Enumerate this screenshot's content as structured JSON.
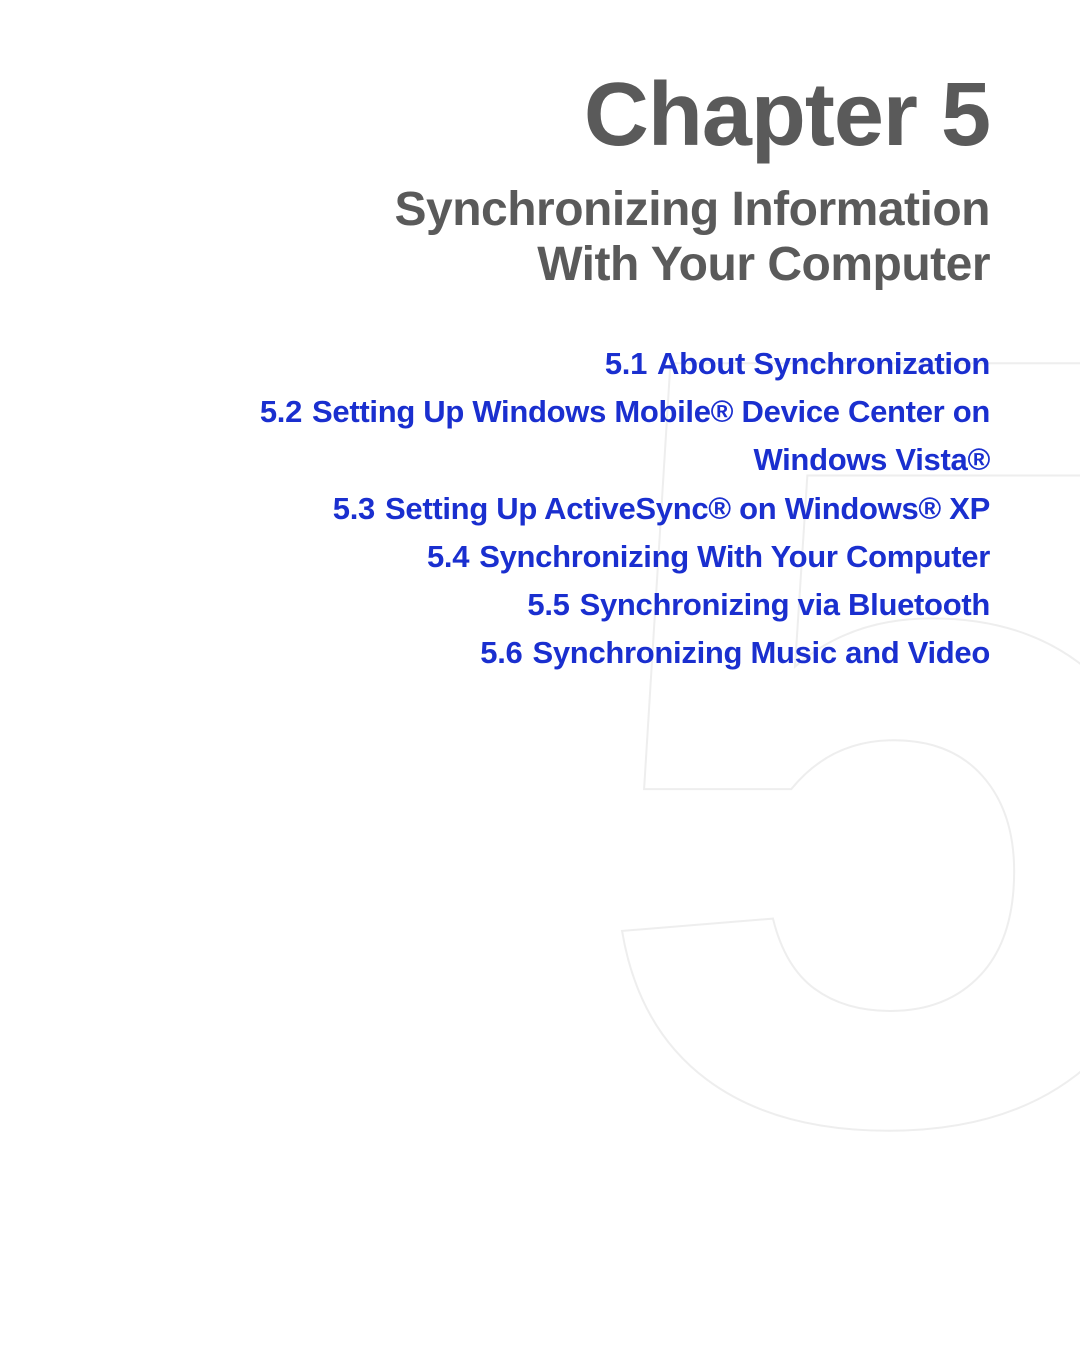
{
  "background_numeral": "5",
  "chapter": {
    "label": "Chapter 5",
    "subtitle_line1": "Synchronizing Information",
    "subtitle_line2": "With Your Computer"
  },
  "toc": [
    {
      "num": "5.1",
      "title": "About Synchronization"
    },
    {
      "num": "5.2",
      "title": "Setting Up Windows Mobile® Device Center on Windows Vista®"
    },
    {
      "num": "5.3",
      "title": "Setting Up ActiveSync® on Windows® XP"
    },
    {
      "num": "5.4",
      "title": "Synchronizing With Your Computer"
    },
    {
      "num": "5.5",
      "title": "Synchronizing via Bluetooth"
    },
    {
      "num": "5.6",
      "title": "Synchronizing Music and Video"
    }
  ]
}
